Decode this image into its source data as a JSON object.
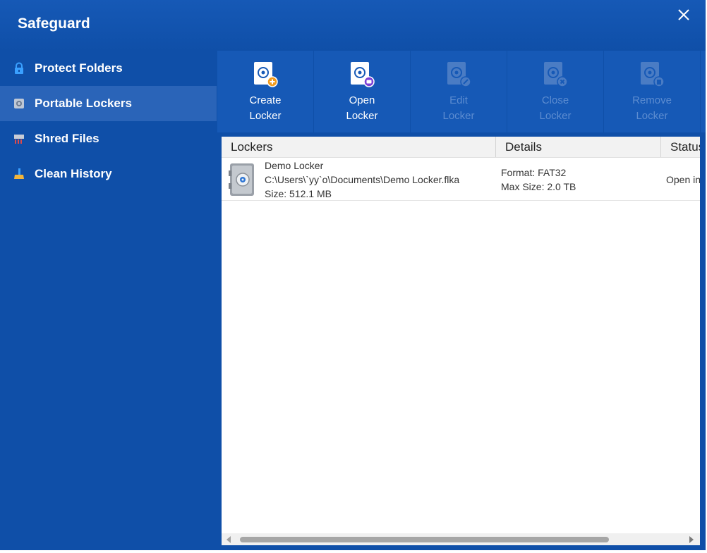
{
  "app": {
    "title": "Safeguard"
  },
  "sidebar": {
    "items": [
      {
        "label": "Protect Folders",
        "icon": "lock-icon"
      },
      {
        "label": "Portable Lockers",
        "icon": "locker-icon",
        "active": true
      },
      {
        "label": "Shred Files",
        "icon": "shredder-icon"
      },
      {
        "label": "Clean History",
        "icon": "broom-icon"
      }
    ]
  },
  "toolbar": {
    "buttons": [
      {
        "label": "Create\nLocker",
        "enabled": true,
        "icon": "create-locker-icon"
      },
      {
        "label": "Open\nLocker",
        "enabled": true,
        "icon": "open-locker-icon"
      },
      {
        "label": "Edit\nLocker",
        "enabled": false,
        "icon": "edit-locker-icon"
      },
      {
        "label": "Close\nLocker",
        "enabled": false,
        "icon": "close-locker-icon"
      },
      {
        "label": "Remove\nLocker",
        "enabled": false,
        "icon": "remove-locker-icon"
      }
    ]
  },
  "table": {
    "columns": [
      "Lockers",
      "Details",
      "Status"
    ],
    "rows": [
      {
        "name": "Demo Locker",
        "path": "C:\\Users\\`yy`o\\Documents\\Demo Locker.flka",
        "size": "Size: 512.1 MB",
        "format": "Format: FAT32",
        "max_size": "Max Size: 2.0 TB",
        "status": "Open in"
      }
    ]
  },
  "colors": {
    "window_bg": "#0f4fa8",
    "toolbar_bg": "#1659b6",
    "active_item": "#2a64b8",
    "disabled_text": "#5c8cd0"
  }
}
